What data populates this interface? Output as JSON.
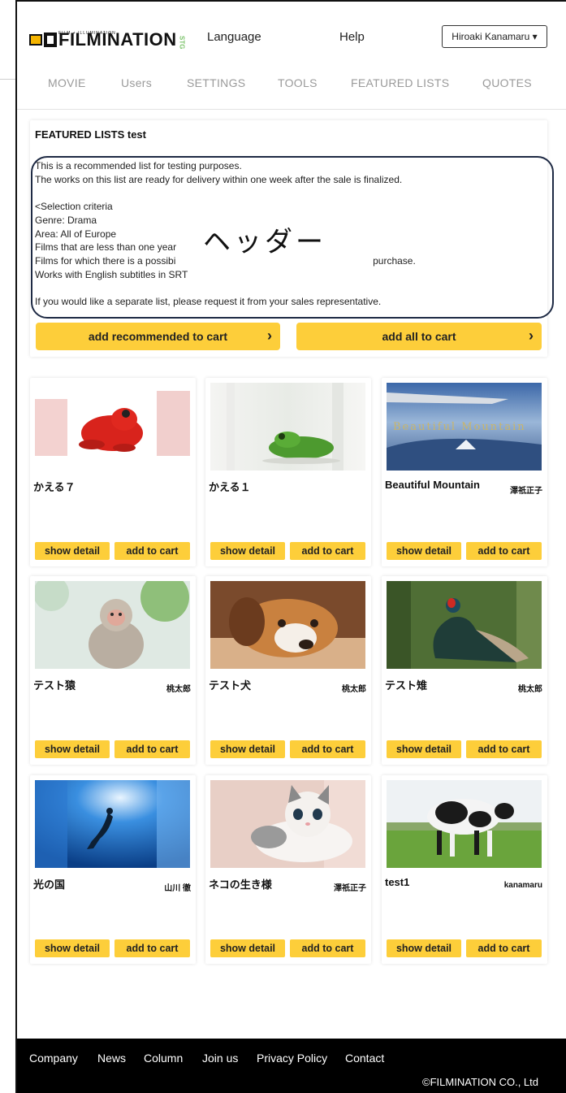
{
  "header": {
    "logo_tagline": "FILM + ILLUMINATION",
    "logo_text": "FILMINATION",
    "logo_env": "STG",
    "language_label": "Language",
    "help_label": "Help",
    "user_label": "Hiroaki Kanamaru ▾"
  },
  "nav": {
    "items": [
      "MOVIE",
      "Users",
      "SETTINGS",
      "TOOLS",
      "FEATURED LISTS",
      "QUOTES"
    ]
  },
  "featured": {
    "title": "FEATURED LISTS  test",
    "description": "This is a recommended list for testing purposes.\nThe works on this list are ready for delivery within one week after the sale is finalized.\n\n<Selection criteria\nGenre: Drama\nArea: All of Europe\nFilms that are less than one year\nFilms for which there is a possibi                                                                  s of purchase.\nWorks with English subtitles in SRT\n\nIf you would like a separate list, please request it from your sales representative.",
    "annotation": "ヘッダー",
    "add_recommended_label": "add recommended to cart",
    "add_all_label": "add all to cart"
  },
  "cards": [
    {
      "title": "かえる７",
      "author": "",
      "thumb": "red-frog"
    },
    {
      "title": "かえる１",
      "author": "",
      "thumb": "green-frog"
    },
    {
      "title": "Beautiful Mountain",
      "author": "澤祇正子",
      "thumb": "mountain",
      "thumb_text": "Beautiful Mountain"
    },
    {
      "title": "テスト猿",
      "author": "桃太郎",
      "thumb": "monkey"
    },
    {
      "title": "テスト犬",
      "author": "桃太郎",
      "thumb": "dog"
    },
    {
      "title": "テスト雉",
      "author": "桃太郎",
      "thumb": "pheasant"
    },
    {
      "title": "光の国",
      "author": "山川 徹",
      "thumb": "diver"
    },
    {
      "title": "ネコの生き様",
      "author": "澤祇正子",
      "thumb": "kitten"
    },
    {
      "title": "test1",
      "author": "kanamaru",
      "thumb": "cow"
    }
  ],
  "card_buttons": {
    "detail_label": "show detail",
    "cart_label": "add to cart"
  },
  "footer": {
    "links": [
      "Company",
      "News",
      "Column",
      "Join us",
      "Privacy Policy",
      "Contact"
    ],
    "copyright": "©FILMINATION CO., Ltd"
  },
  "colors": {
    "accent": "#fdce3a",
    "footer_bg": "#000000",
    "nav_text": "#9a9a9a"
  }
}
